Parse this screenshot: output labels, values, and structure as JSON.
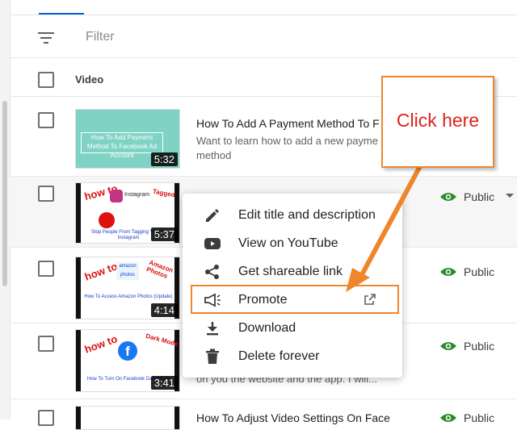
{
  "filter": {
    "placeholder": "Filter"
  },
  "table": {
    "video_header": "Video"
  },
  "rows": [
    {
      "title": "How To Add A Payment Method To F",
      "desc_line1": "Want to learn how to add a new payme",
      "desc_line2": "method",
      "duration": "5:32",
      "thumb_text": "How To Add Payment Method To Facebook Ad Account"
    },
    {
      "duration": "5:37",
      "visibility": "Public",
      "thumb_top": "how to",
      "thumb_brand": "Instagram",
      "thumb_right": "Tagged",
      "thumb_caption": "Stop People From Tagging You On Instagram"
    },
    {
      "duration": "4:14",
      "visibility": "Public",
      "thumb_top": "how to",
      "thumb_brand": "amazon photos",
      "thumb_right": "Amazon Photos",
      "thumb_caption": "How To Access Amazon Photos (Update)"
    },
    {
      "duration": "3:41",
      "visibility": "Public",
      "thumb_top": "how to",
      "thumb_right": "Dark Mode",
      "thumb_caption": "How To Turn On Facebook Dark Mode",
      "partial_desc": "on you the website and the app. I will..."
    },
    {
      "visibility": "Public",
      "partial_title": "How To Adjust Video Settings On Face"
    }
  ],
  "menu": {
    "items": [
      {
        "label": "Edit title and description",
        "icon": "pencil-icon"
      },
      {
        "label": "View on YouTube",
        "icon": "youtube-icon"
      },
      {
        "label": "Get shareable link",
        "icon": "share-icon"
      },
      {
        "label": "Promote",
        "icon": "megaphone-icon"
      },
      {
        "label": "Download",
        "icon": "download-icon"
      },
      {
        "label": "Delete forever",
        "icon": "trash-icon"
      }
    ]
  },
  "annotation": {
    "callout_text": "Click here",
    "color": "#f0862c",
    "text_color": "#e0211c"
  },
  "colors": {
    "public_eye": "#2a8a2a",
    "accent": "#065fd4"
  }
}
